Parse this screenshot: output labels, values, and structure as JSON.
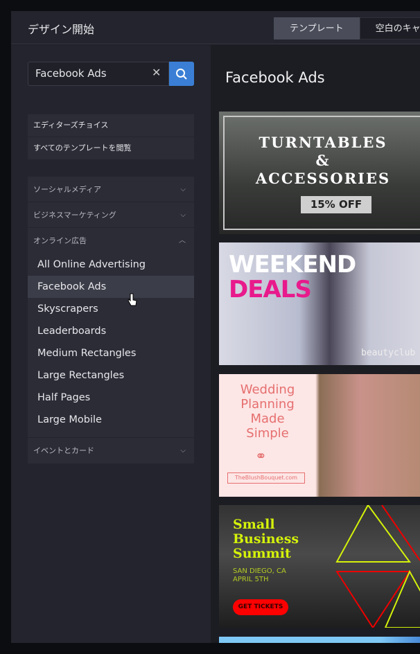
{
  "header": {
    "title": "デザイン開始",
    "tabs": [
      {
        "label": "テンプレート",
        "active": true
      },
      {
        "label": "空白のキャンバス",
        "active": false
      }
    ]
  },
  "sidebar": {
    "search": {
      "value": "Facebook Ads",
      "clear_icon": "close-icon",
      "search_icon": "search-icon"
    },
    "menu": [
      {
        "label": "エディターズチョイス"
      },
      {
        "label": "すべてのテンプレートを閲覧"
      }
    ],
    "categories": [
      {
        "label": "ソーシャルメディア",
        "expanded": false
      },
      {
        "label": "ビジネスマーケティング",
        "expanded": false
      },
      {
        "label": "オンライン広告",
        "expanded": true,
        "items": [
          "All Online Advertising",
          "Facebook Ads",
          "Skyscrapers",
          "Leaderboards",
          "Medium Rectangles",
          "Large Rectangles",
          "Half Pages",
          "Large Mobile"
        ],
        "selected": "Facebook Ads"
      },
      {
        "label": "イベントとカード",
        "expanded": false
      }
    ]
  },
  "main": {
    "title": "Facebook Ads",
    "templates": [
      {
        "line1": "TURNTABLES",
        "line2": "&",
        "line3": "ACCESSORIES",
        "badge": "15% OFF"
      },
      {
        "line1": "WEEKEND",
        "line2": "DEALS",
        "brand": "beautyclub"
      },
      {
        "line1": "Wedding",
        "line2": "Planning",
        "line3": "Made",
        "line4": "Simple",
        "brand": "TheBlushBouquet.com"
      },
      {
        "line1": "Small",
        "line2": "Business",
        "line3": "Summit",
        "line4": "San Diego, CA",
        "line5": "April 5th",
        "button": "GET TICKETS"
      }
    ]
  },
  "colors": {
    "accent": "#3a7fd5",
    "selected": "#3b3d48"
  }
}
